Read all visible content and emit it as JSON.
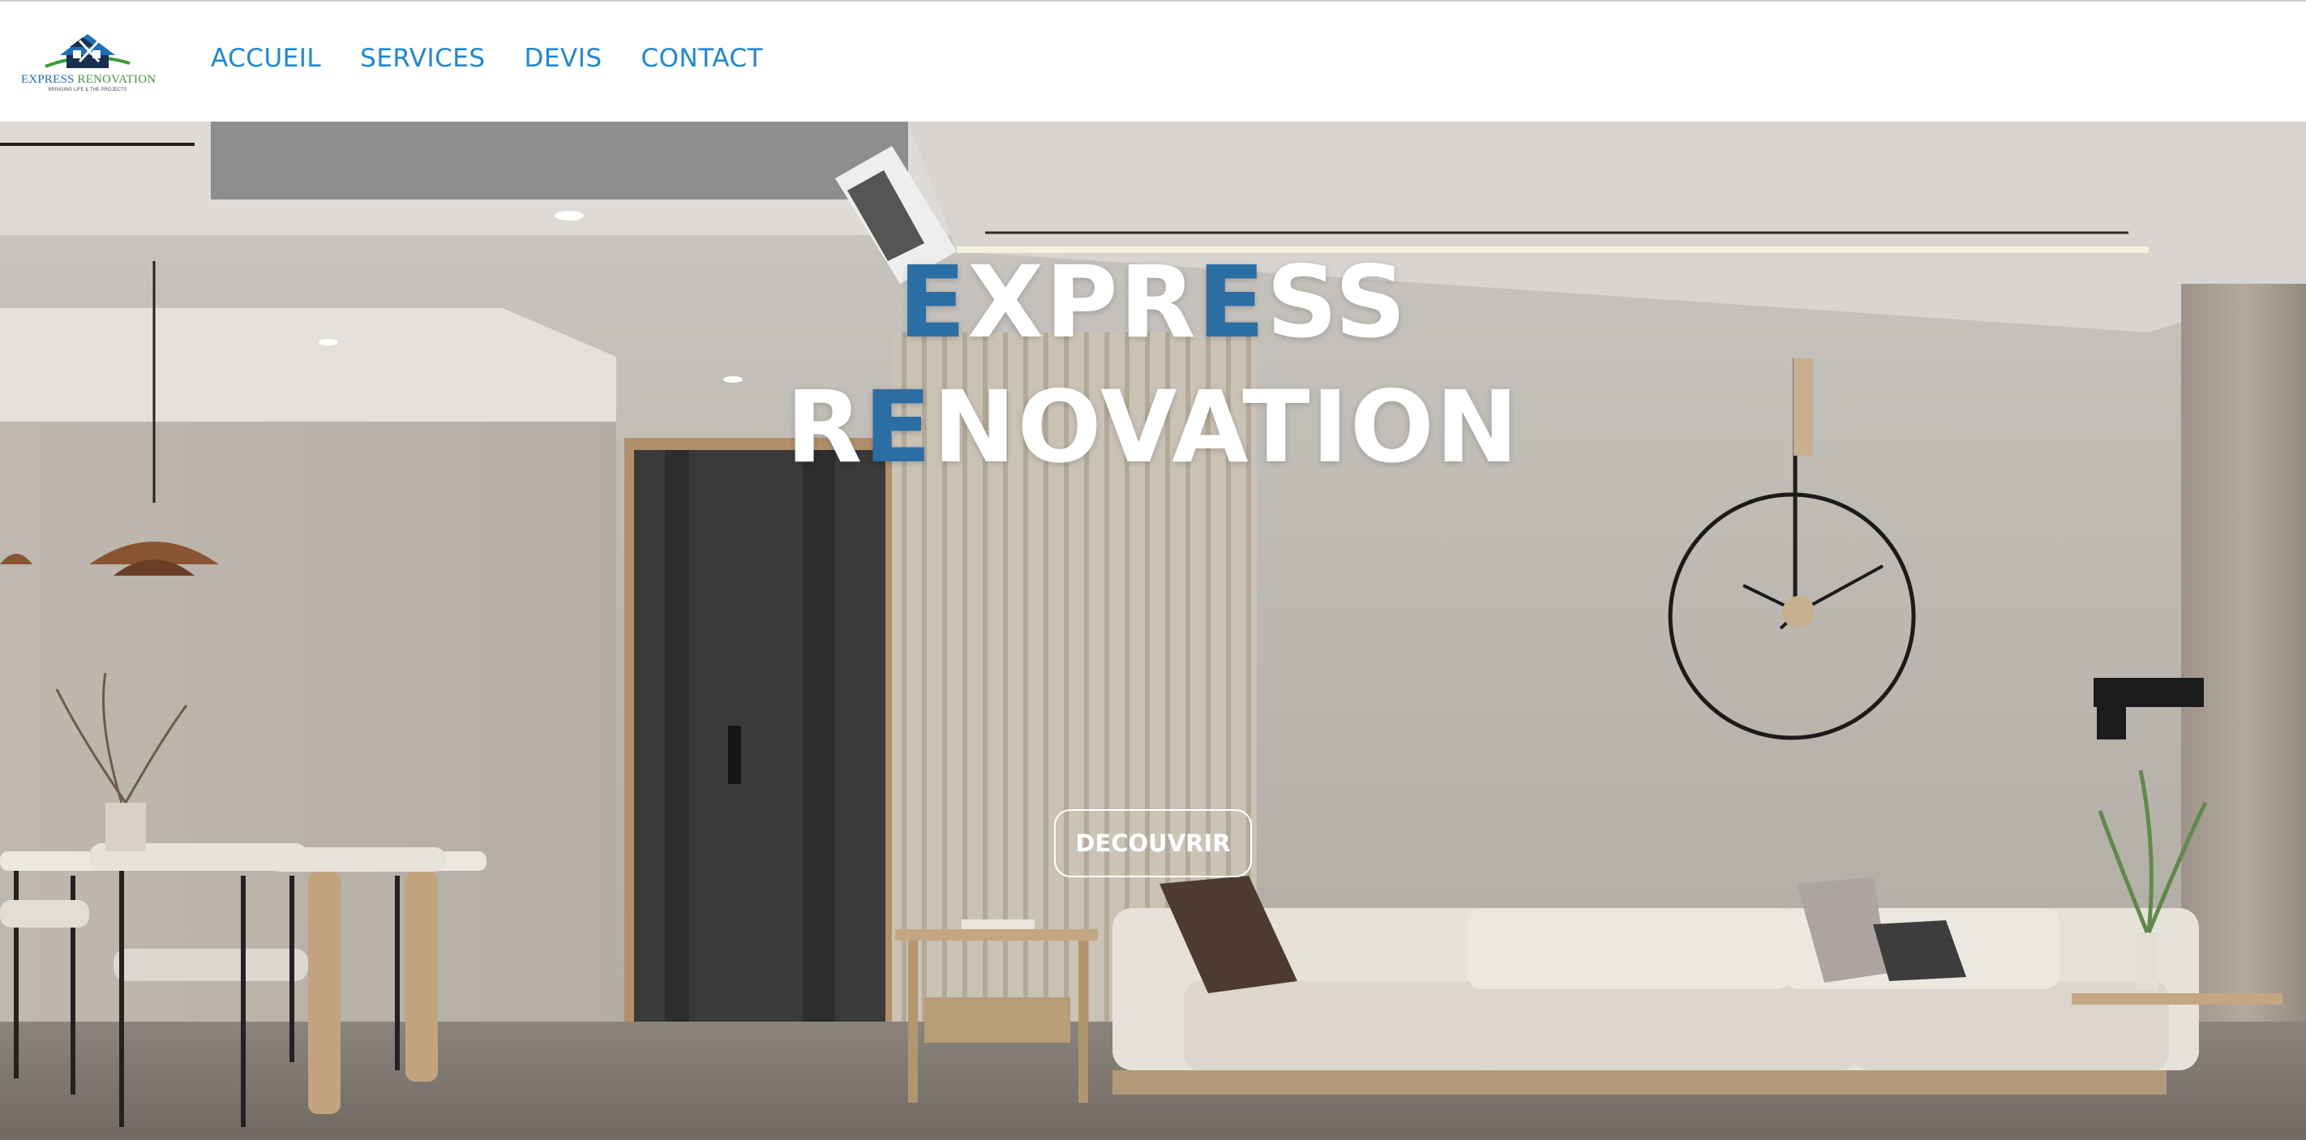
{
  "header": {
    "logo": {
      "brand_word_1": "EXPRESS",
      "brand_word_2": "RENOVATION",
      "tagline": "BRINGING LIFE & THE PROJECTS",
      "icon": "house-logo-icon",
      "colors": {
        "blue": "#1f6fb5",
        "green": "#3c9a3c",
        "navy": "#17304f"
      }
    },
    "nav": [
      {
        "label": "ACCUEIL"
      },
      {
        "label": "SERVICES"
      },
      {
        "label": "DEVIS"
      },
      {
        "label": "CONTACT"
      }
    ],
    "nav_color": "#1e88d6"
  },
  "hero": {
    "title_line_1": {
      "accent_1": "E",
      "part_1": "XPR",
      "accent_2": "E",
      "part_2": "SS"
    },
    "title_line_2": {
      "part_1": "R",
      "accent_1": "E",
      "part_2": "NOVATION"
    },
    "accent_color": "#2b6ea3",
    "cta_label": "DECOUVRIR",
    "background": "modern-living-room-photo"
  }
}
